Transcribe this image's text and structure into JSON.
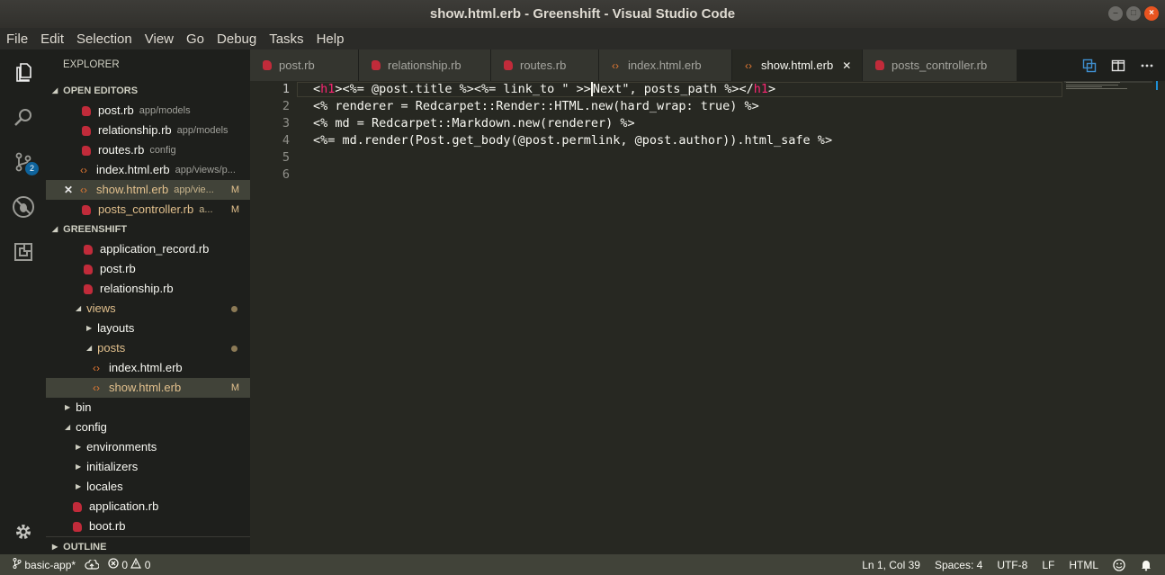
{
  "window": {
    "title": "show.html.erb - Greenshift - Visual Studio Code"
  },
  "menu": [
    "File",
    "Edit",
    "Selection",
    "View",
    "Go",
    "Debug",
    "Tasks",
    "Help"
  ],
  "activity": {
    "scm_badge": "2"
  },
  "sidebar": {
    "title": "EXPLORER",
    "open_editors_label": "OPEN EDITORS",
    "open_editors": [
      {
        "name": "post.rb",
        "desc": "app/models",
        "status": ""
      },
      {
        "name": "relationship.rb",
        "desc": "app/models",
        "status": ""
      },
      {
        "name": "routes.rb",
        "desc": "config",
        "status": ""
      },
      {
        "name": "index.html.erb",
        "desc": "app/views/p...",
        "status": ""
      },
      {
        "name": "show.html.erb",
        "desc": "app/vie...",
        "status": "M"
      },
      {
        "name": "posts_controller.rb",
        "desc": "a...",
        "status": "M"
      }
    ],
    "project_label": "GREENSHIFT",
    "tree": [
      {
        "name": "application_record.rb"
      },
      {
        "name": "post.rb"
      },
      {
        "name": "relationship.rb"
      },
      {
        "name": "views"
      },
      {
        "name": "layouts"
      },
      {
        "name": "posts"
      },
      {
        "name": "index.html.erb"
      },
      {
        "name": "show.html.erb",
        "status": "M"
      },
      {
        "name": "bin"
      },
      {
        "name": "config"
      },
      {
        "name": "environments"
      },
      {
        "name": "initializers"
      },
      {
        "name": "locales"
      },
      {
        "name": "application.rb"
      },
      {
        "name": "boot.rb"
      }
    ],
    "outline_label": "OUTLINE"
  },
  "tabs": [
    {
      "label": "post.rb"
    },
    {
      "label": "relationship.rb"
    },
    {
      "label": "routes.rb"
    },
    {
      "label": "index.html.erb"
    },
    {
      "label": "show.html.erb"
    },
    {
      "label": "posts_controller.rb"
    }
  ],
  "editor": {
    "line_numbers": [
      "1",
      "2",
      "3",
      "4",
      "5",
      "6"
    ],
    "lines": {
      "l1a": "<",
      "l1tag": "h1",
      "l1b": "><%= @post.title %><%= link_to \" >>",
      "l1c": "Next\", posts_path %></",
      "l1tag2": "h1",
      "l1d": ">",
      "l2": "<% renderer = Redcarpet::Render::HTML.new(hard_wrap: true) %>",
      "l3": "<% md = Redcarpet::Markdown.new(renderer) %>",
      "l4": "<%= md.render(Post.get_body(@post.permlink, @post.author)).html_safe %>"
    }
  },
  "status": {
    "branch": "basic-app*",
    "errors": "0",
    "warnings": "0",
    "position": "Ln 1, Col 39",
    "spaces": "Spaces: 4",
    "encoding": "UTF-8",
    "eol": "LF",
    "language": "HTML"
  },
  "colors": {
    "accent": "#0e639c",
    "rb_icon": "#c12b3a",
    "html_icon": "#e37933",
    "modified": "#e2c08d",
    "status_bg": "#414339"
  }
}
